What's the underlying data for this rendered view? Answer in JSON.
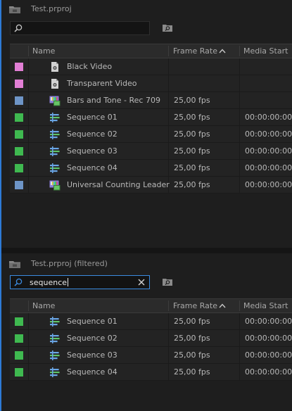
{
  "colors": {
    "accent": "#2d7ad6",
    "violet": "#e27fd5",
    "blue": "#6e95c7",
    "green": "#3fb950"
  },
  "panel1": {
    "title": "Test.prproj",
    "search": {
      "value": ""
    },
    "columns": {
      "name": "Name",
      "frame_rate": "Frame Rate",
      "media_start": "Media Start"
    },
    "rows": [
      {
        "color": "violet",
        "icon": "still-image-icon",
        "name": "Black Video",
        "frame_rate": "",
        "media_start": ""
      },
      {
        "color": "violet",
        "icon": "still-image-icon",
        "name": "Transparent Video",
        "frame_rate": "",
        "media_start": ""
      },
      {
        "color": "blue",
        "icon": "synthetic-media-icon",
        "name": "Bars and Tone - Rec 709",
        "frame_rate": "25,00 fps",
        "media_start": ""
      },
      {
        "color": "green",
        "icon": "sequence-icon",
        "name": "Sequence 01",
        "frame_rate": "25,00 fps",
        "media_start": "00:00:00:00"
      },
      {
        "color": "green",
        "icon": "sequence-icon",
        "name": "Sequence 02",
        "frame_rate": "25,00 fps",
        "media_start": "00:00:00:00"
      },
      {
        "color": "green",
        "icon": "sequence-icon",
        "name": "Sequence 03",
        "frame_rate": "25,00 fps",
        "media_start": "00:00:00:00"
      },
      {
        "color": "green",
        "icon": "sequence-icon",
        "name": "Sequence 04",
        "frame_rate": "25,00 fps",
        "media_start": "00:00:00:00"
      },
      {
        "color": "blue",
        "icon": "synthetic-media-icon",
        "name": "Universal Counting Leader",
        "frame_rate": "25,00 fps",
        "media_start": "00:00:00:00"
      }
    ]
  },
  "panel2": {
    "title": "Test.prproj (filtered)",
    "search": {
      "value": "sequence"
    },
    "columns": {
      "name": "Name",
      "frame_rate": "Frame Rate",
      "media_start": "Media Start"
    },
    "rows": [
      {
        "color": "green",
        "icon": "sequence-icon",
        "name": "Sequence 01",
        "frame_rate": "25,00 fps",
        "media_start": "00:00:00:00"
      },
      {
        "color": "green",
        "icon": "sequence-icon",
        "name": "Sequence 02",
        "frame_rate": "25,00 fps",
        "media_start": "00:00:00:00"
      },
      {
        "color": "green",
        "icon": "sequence-icon",
        "name": "Sequence 03",
        "frame_rate": "25,00 fps",
        "media_start": "00:00:00:00"
      },
      {
        "color": "green",
        "icon": "sequence-icon",
        "name": "Sequence 04",
        "frame_rate": "25,00 fps",
        "media_start": "00:00:00:00"
      }
    ]
  }
}
